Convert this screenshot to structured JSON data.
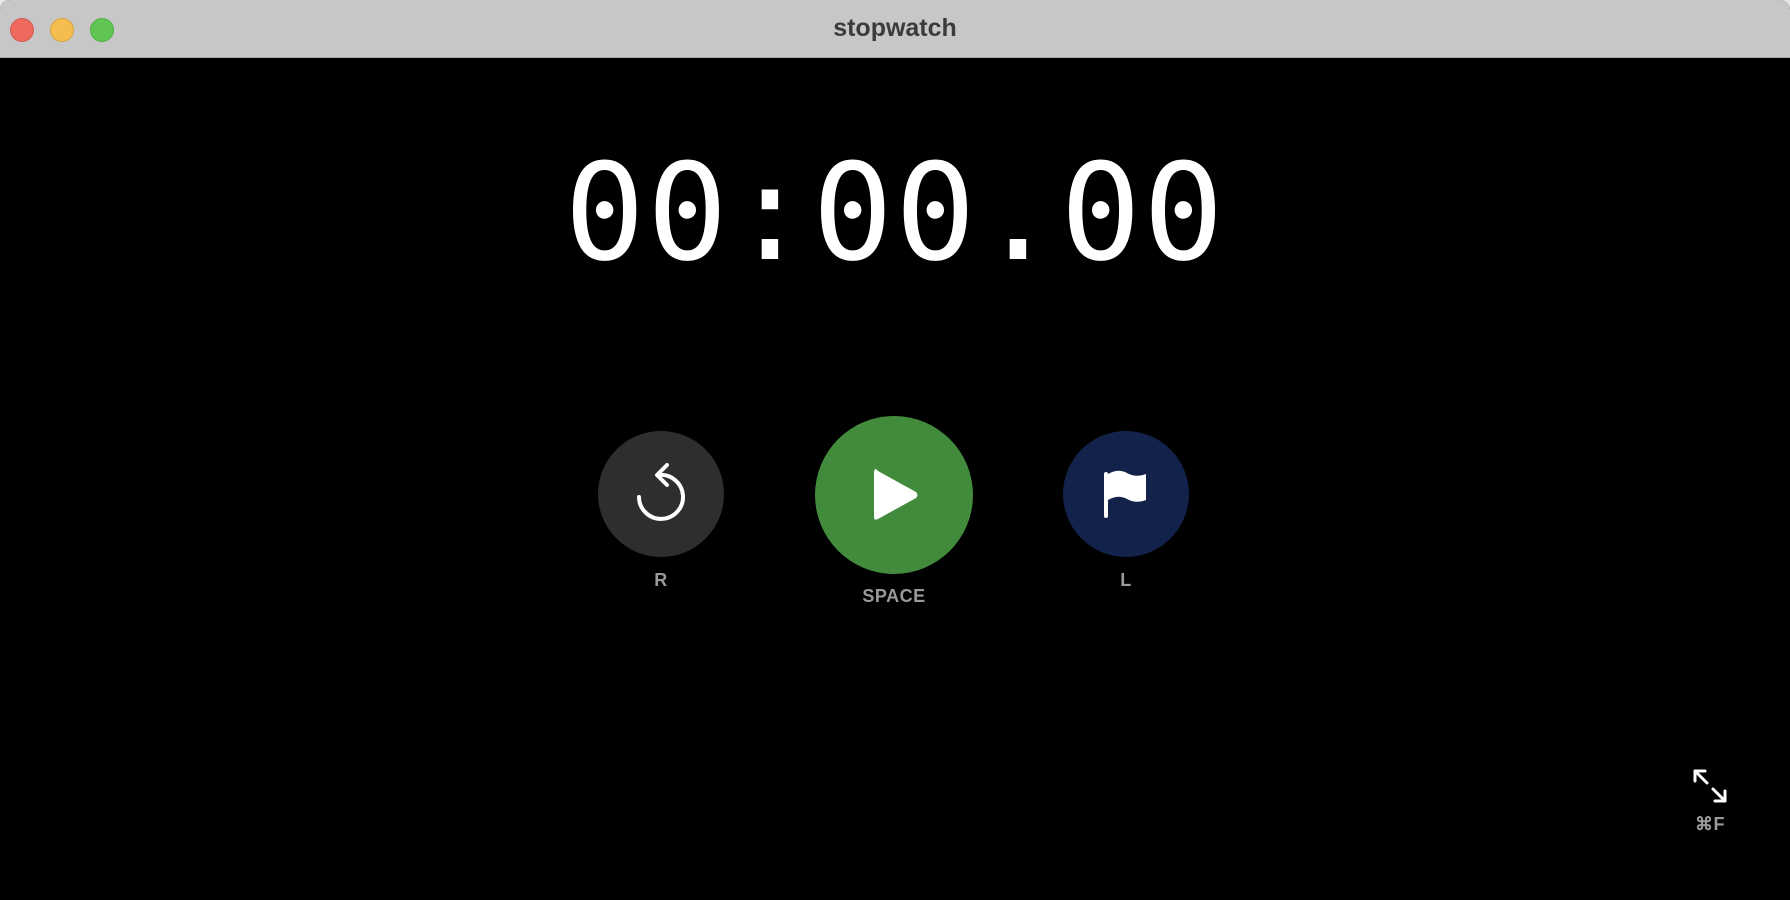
{
  "window": {
    "title": "stopwatch"
  },
  "display": {
    "time": "00:00.00"
  },
  "controls": {
    "reset_key": "R",
    "play_key": "SPACE",
    "lap_key": "L"
  },
  "fullscreen": {
    "shortcut": "⌘F",
    "icon": "expand-icon"
  },
  "colors": {
    "reset_button": "#2e2e2e",
    "play_button": "#428b3d",
    "lap_button": "#12224a",
    "background": "#000000",
    "titlebar": "#c7c7c7"
  }
}
